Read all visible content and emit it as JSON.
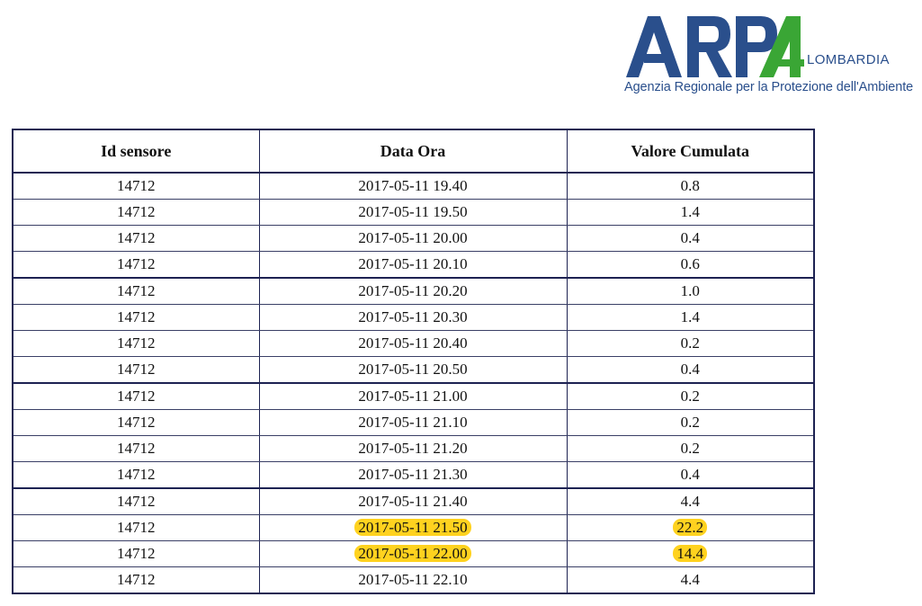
{
  "logo": {
    "wordmark": "ARPA",
    "region": "LOMBARDIA",
    "subtitle": "Agenzia Regionale per la Protezione dell'Ambiente",
    "colors": {
      "blue": "#2a4f8c",
      "green": "#3aa635"
    }
  },
  "table": {
    "headers": [
      "Id sensore",
      "Data Ora",
      "Valore Cumulata"
    ],
    "rows": [
      {
        "id": "14712",
        "datetime": "2017-05-11 19.40",
        "value": "0.8",
        "highlighted": false
      },
      {
        "id": "14712",
        "datetime": "2017-05-11 19.50",
        "value": "1.4",
        "highlighted": false
      },
      {
        "id": "14712",
        "datetime": "2017-05-11 20.00",
        "value": "0.4",
        "highlighted": false
      },
      {
        "id": "14712",
        "datetime": "2017-05-11 20.10",
        "value": "0.6",
        "highlighted": false
      },
      {
        "id": "14712",
        "datetime": "2017-05-11 20.20",
        "value": "1.0",
        "highlighted": false
      },
      {
        "id": "14712",
        "datetime": "2017-05-11 20.30",
        "value": "1.4",
        "highlighted": false
      },
      {
        "id": "14712",
        "datetime": "2017-05-11 20.40",
        "value": "0.2",
        "highlighted": false
      },
      {
        "id": "14712",
        "datetime": "2017-05-11 20.50",
        "value": "0.4",
        "highlighted": false
      },
      {
        "id": "14712",
        "datetime": "2017-05-11 21.00",
        "value": "0.2",
        "highlighted": false
      },
      {
        "id": "14712",
        "datetime": "2017-05-11 21.10",
        "value": "0.2",
        "highlighted": false
      },
      {
        "id": "14712",
        "datetime": "2017-05-11 21.20",
        "value": "0.2",
        "highlighted": false
      },
      {
        "id": "14712",
        "datetime": "2017-05-11 21.30",
        "value": "0.4",
        "highlighted": false
      },
      {
        "id": "14712",
        "datetime": "2017-05-11 21.40",
        "value": "4.4",
        "highlighted": false
      },
      {
        "id": "14712",
        "datetime": "2017-05-11 21.50",
        "value": "22.2",
        "highlighted": true
      },
      {
        "id": "14712",
        "datetime": "2017-05-11 22.00",
        "value": "14.4",
        "highlighted": true
      },
      {
        "id": "14712",
        "datetime": "2017-05-11 22.10",
        "value": "4.4",
        "highlighted": false
      }
    ],
    "highlight_color": "#ffd21f"
  }
}
